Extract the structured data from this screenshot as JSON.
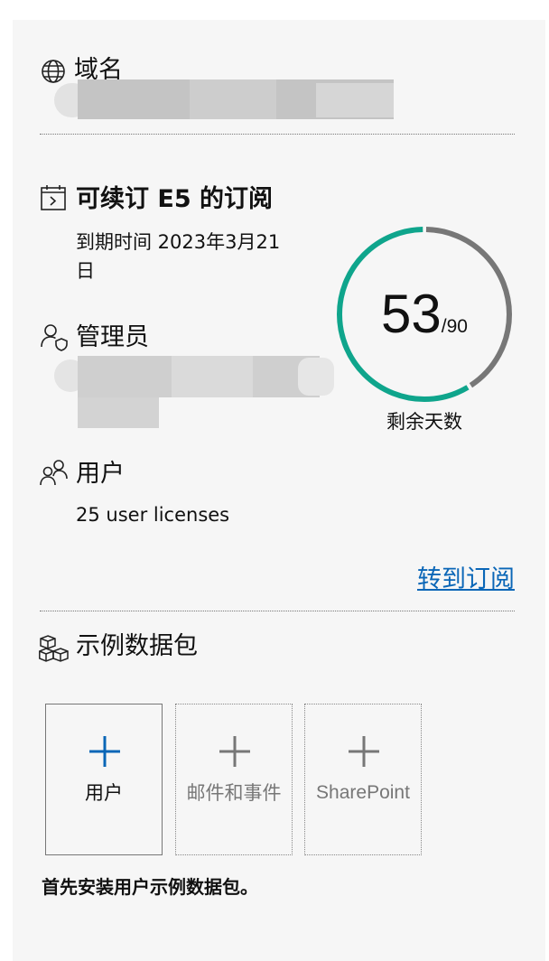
{
  "domain_section": {
    "title": "域名"
  },
  "subscription": {
    "title": "可续订 E5 的订阅",
    "expiry_line1": "到期时间 2023年3月21",
    "expiry_line2": "日"
  },
  "admins_section": {
    "title": "管理员"
  },
  "users_section": {
    "title": "用户",
    "licenses": "25 user licenses"
  },
  "days_ring": {
    "remaining": "53",
    "total": "/90",
    "remaining_value": 53,
    "total_value": 90,
    "label": "剩余天数",
    "color_remaining": "#0fa58c",
    "color_elapsed": "#777777"
  },
  "goto_link": "转到订阅",
  "sample_packs": {
    "title": "示例数据包",
    "tiles": [
      {
        "label": "用户",
        "icon": "plus-icon",
        "color": "#0a66b7",
        "selected": true
      },
      {
        "label": "邮件和事件",
        "icon": "plus-icon",
        "color": "#777777",
        "selected": false
      },
      {
        "label": "SharePoint",
        "icon": "plus-icon",
        "color": "#777777",
        "selected": false
      }
    ],
    "hint": "首先安装用户示例数据包。"
  }
}
